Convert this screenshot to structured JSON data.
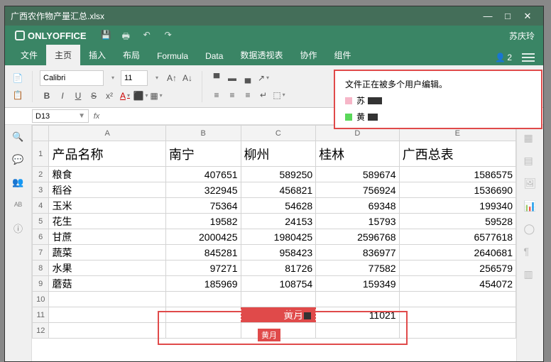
{
  "window": {
    "title": "广西农作物产量汇总.xlsx"
  },
  "user": "苏庆玲",
  "tabs": [
    "文件",
    "主页",
    "插入",
    "布局",
    "Formula",
    "Data",
    "数据透视表",
    "协作",
    "组件"
  ],
  "activeTab": 1,
  "font": {
    "name": "Calibri",
    "size": "11"
  },
  "cellref": "D13",
  "coedit": {
    "title": "文件正在被多个用户编辑。",
    "users": [
      {
        "name": "苏",
        "color": "#f6b6c8"
      },
      {
        "name": "黄",
        "color": "#5ad85a"
      }
    ]
  },
  "presence": {
    "count": "2"
  },
  "columns": [
    "A",
    "B",
    "C",
    "D",
    "E"
  ],
  "rows": [
    {
      "n": "1",
      "cells": [
        "产品名称",
        "南宁",
        "柳州",
        "桂林",
        "广西总表"
      ],
      "head": true
    },
    {
      "n": "2",
      "cells": [
        "粮食",
        "407651",
        "589250",
        "589674",
        "1586575"
      ]
    },
    {
      "n": "3",
      "cells": [
        "稻谷",
        "322945",
        "456821",
        "756924",
        "1536690"
      ]
    },
    {
      "n": "4",
      "cells": [
        "玉米",
        "75364",
        "54628",
        "69348",
        "199340"
      ]
    },
    {
      "n": "5",
      "cells": [
        "花生",
        "19582",
        "24153",
        "15793",
        "59528"
      ]
    },
    {
      "n": "6",
      "cells": [
        "甘蔗",
        "2000425",
        "1980425",
        "2596768",
        "6577618"
      ]
    },
    {
      "n": "7",
      "cells": [
        "蔬菜",
        "845281",
        "958423",
        "836977",
        "2640681"
      ]
    },
    {
      "n": "8",
      "cells": [
        "水果",
        "97271",
        "81726",
        "77582",
        "256579"
      ]
    },
    {
      "n": "9",
      "cells": [
        "蘑菇",
        "185969",
        "108754",
        "159349",
        "454072"
      ]
    },
    {
      "n": "10",
      "cells": [
        "",
        "",
        "",
        "",
        ""
      ]
    },
    {
      "n": "11",
      "cells": [
        "",
        "",
        "黄月",
        "11021",
        ""
      ]
    },
    {
      "n": "12",
      "cells": [
        "",
        "",
        "",
        "",
        ""
      ]
    }
  ],
  "coedit_user_label": "黄月"
}
